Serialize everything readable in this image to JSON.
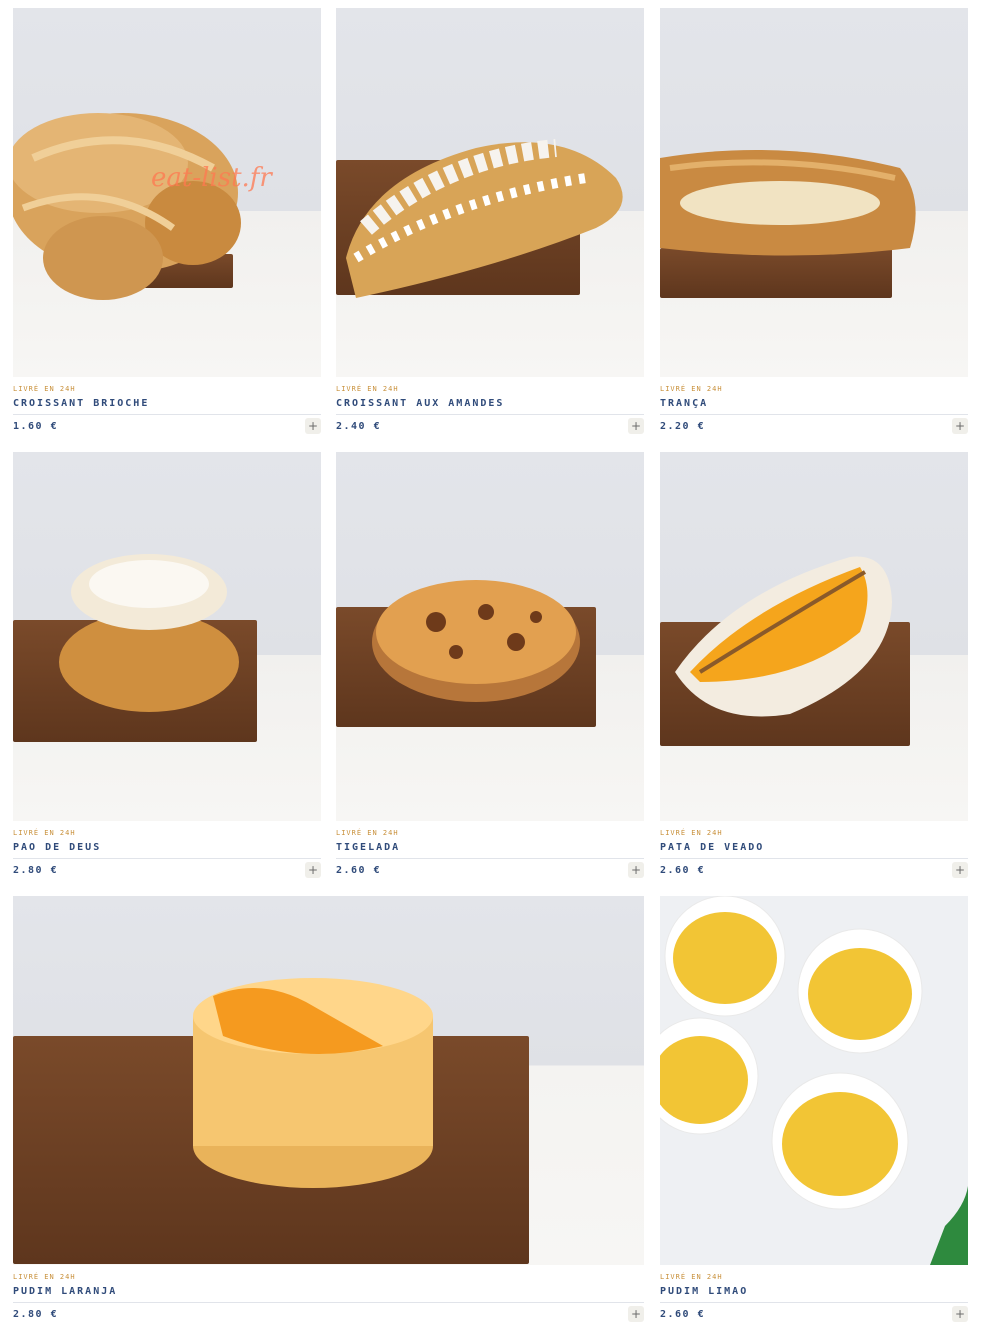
{
  "products": [
    {
      "delivery": "LIVRÉ EN 24H",
      "name": "CROISSANT BRIOCHE",
      "price": "1.60 €",
      "add_label": "+"
    },
    {
      "delivery": "LIVRÉ EN 24H",
      "name": "CROISSANT AUX AMANDES",
      "price": "2.40 €",
      "add_label": "+"
    },
    {
      "delivery": "LIVRÉ EN 24H",
      "name": "TRANÇA",
      "price": "2.20 €",
      "add_label": "+"
    },
    {
      "delivery": "LIVRÉ EN 24H",
      "name": "PAO DE DEUS",
      "price": "2.80 €",
      "add_label": "+"
    },
    {
      "delivery": "LIVRÉ EN 24H",
      "name": "TIGELADA",
      "price": "2.60 €",
      "add_label": "+"
    },
    {
      "delivery": "LIVRÉ EN 24H",
      "name": "PATA DE VEADO",
      "price": "2.60 €",
      "add_label": "+"
    },
    {
      "delivery": "LIVRÉ EN 24H",
      "name": "PUDIM LARANJA",
      "price": "2.80 €",
      "add_label": "+"
    },
    {
      "delivery": "LIVRÉ EN 24H",
      "name": "PUDIM LIMAO",
      "price": "2.60 €",
      "add_label": "+"
    }
  ],
  "watermark": "eat-list.fr"
}
